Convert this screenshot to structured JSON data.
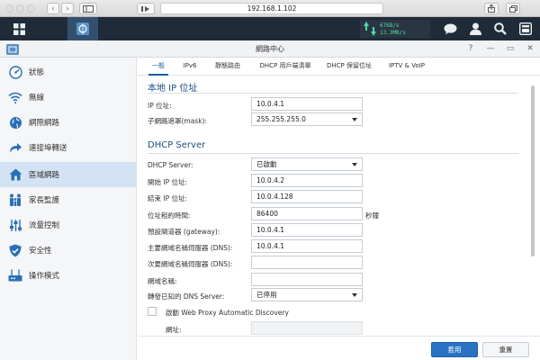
{
  "browser": {
    "address": "192.168.1.102",
    "back_glyph": "‹",
    "forward_glyph": "›",
    "icons": [
      "back-icon",
      "forward-icon",
      "sidebar-icon",
      "reader-icon",
      "share-icon",
      "tabs-icon"
    ]
  },
  "taskbar": {
    "upload_speed": "67KB/s",
    "download_speed": "13.3MB/s",
    "icons": [
      "main-menu-icon",
      "network-center-app-icon",
      "chat-icon",
      "user-icon",
      "search-icon",
      "widgets-icon"
    ]
  },
  "window": {
    "title": "網路中心",
    "controls": {
      "help": "?",
      "minimize": "—",
      "maximize": "▭",
      "close": "✕"
    }
  },
  "sidebar": {
    "items": [
      {
        "label": "狀態",
        "icon": "gauge-icon"
      },
      {
        "label": "無線",
        "icon": "wifi-icon"
      },
      {
        "label": "網際網路",
        "icon": "globe-icon"
      },
      {
        "label": "連接埠轉送",
        "icon": "forward-arrow-icon"
      },
      {
        "label": "區域網路",
        "icon": "house-icon",
        "active": true
      },
      {
        "label": "家長監護",
        "icon": "family-icon"
      },
      {
        "label": "流量控制",
        "icon": "sliders-icon"
      },
      {
        "label": "安全性",
        "icon": "shield-icon"
      },
      {
        "label": "操作模式",
        "icon": "router-icon"
      }
    ]
  },
  "tabs": [
    {
      "label": "一般",
      "active": true
    },
    {
      "label": "IPv6"
    },
    {
      "label": "靜態路由"
    },
    {
      "label": "DHCP 用戶端清單"
    },
    {
      "label": "DHCP 保留位址"
    },
    {
      "label": "IPTV & VoIP"
    }
  ],
  "local_ip": {
    "title": "本地 IP 位址",
    "ip_label": "IP 位址:",
    "ip_value": "10.0.4.1",
    "mask_label": "子網路遮罩(mask):",
    "mask_value": "255.255.255.0"
  },
  "dhcp": {
    "title": "DHCP Server",
    "server_label": "DHCP Server:",
    "server_value": "已啟動",
    "start_label": "開始 IP 位址:",
    "start_value": "10.0.4.2",
    "end_label": "結束 IP 位址:",
    "end_value": "10.0.4.128",
    "lease_label": "位址租約時間:",
    "lease_value": "86400",
    "lease_unit": "秒鐘",
    "gateway_label": "預設閘道器 (gateway):",
    "gateway_value": "10.0.4.1",
    "dns1_label": "主要網域名稱伺服器 (DNS):",
    "dns1_value": "10.0.4.1",
    "dns2_label": "次要網域名稱伺服器 (DNS):",
    "dns2_value": "",
    "domain_label": "網域名稱:",
    "domain_value": "",
    "forward_dns_label": "轉發已知的 DNS Server:",
    "forward_dns_value": "已停用",
    "wpad_label": "啟動 Web Proxy Automatic Discovery",
    "url_label": "網址:",
    "url_value": ""
  },
  "footer": {
    "apply": "套用",
    "reset": "重置"
  }
}
